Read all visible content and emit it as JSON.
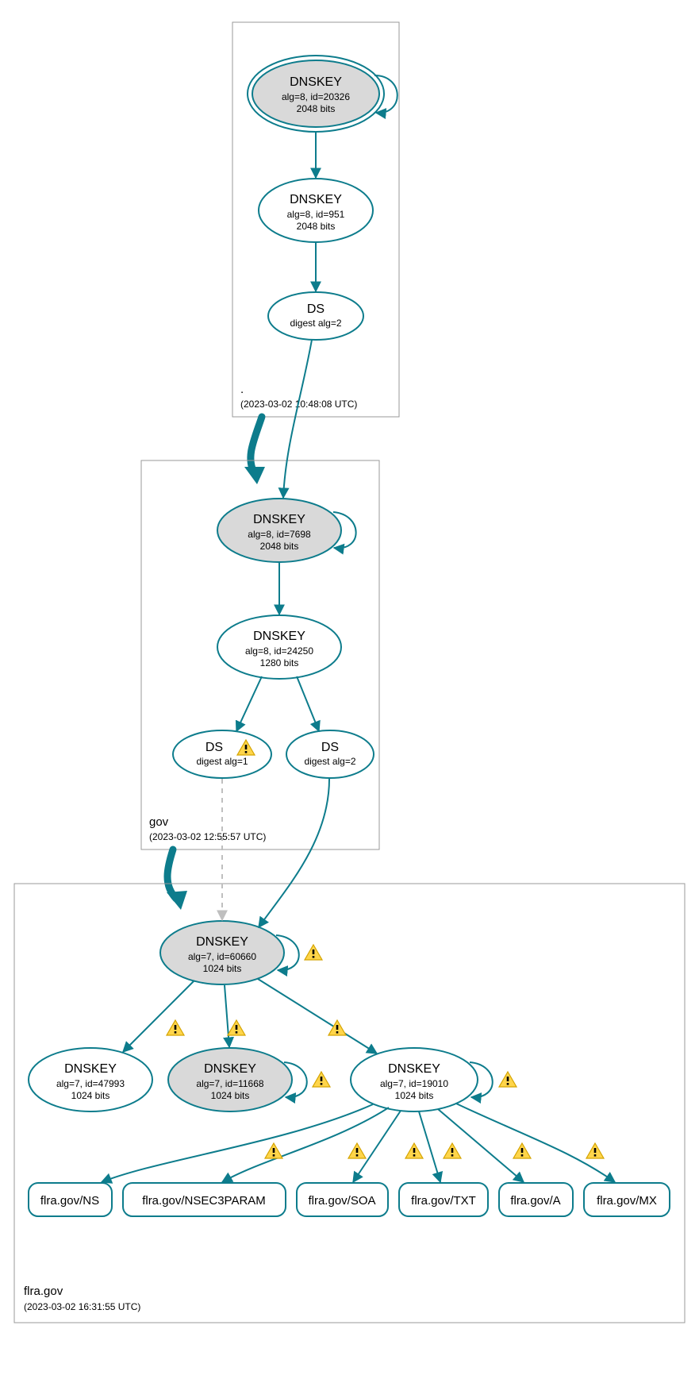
{
  "colors": {
    "stroke": "#0d7c8c",
    "fill_grey": "#d9d9d9"
  },
  "zones": {
    "root": {
      "label": ".",
      "timestamp": "(2023-03-02 10:48:08 UTC)"
    },
    "gov": {
      "label": "gov",
      "timestamp": "(2023-03-02 12:55:57 UTC)"
    },
    "flra": {
      "label": "flra.gov",
      "timestamp": "(2023-03-02 16:31:55 UTC)"
    }
  },
  "nodes": {
    "root_ksk": {
      "title": "DNSKEY",
      "line1": "alg=8, id=20326",
      "line2": "2048 bits"
    },
    "root_zsk": {
      "title": "DNSKEY",
      "line1": "alg=8, id=951",
      "line2": "2048 bits"
    },
    "root_ds": {
      "title": "DS",
      "line1": "digest alg=2"
    },
    "gov_ksk": {
      "title": "DNSKEY",
      "line1": "alg=8, id=7698",
      "line2": "2048 bits"
    },
    "gov_zsk": {
      "title": "DNSKEY",
      "line1": "alg=8, id=24250",
      "line2": "1280 bits"
    },
    "gov_ds1": {
      "title": "DS",
      "line1": "digest alg=1"
    },
    "gov_ds2": {
      "title": "DS",
      "line1": "digest alg=2"
    },
    "flra_ksk": {
      "title": "DNSKEY",
      "line1": "alg=7, id=60660",
      "line2": "1024 bits"
    },
    "flra_k47": {
      "title": "DNSKEY",
      "line1": "alg=7, id=47993",
      "line2": "1024 bits"
    },
    "flra_k11": {
      "title": "DNSKEY",
      "line1": "alg=7, id=11668",
      "line2": "1024 bits"
    },
    "flra_k19": {
      "title": "DNSKEY",
      "line1": "alg=7, id=19010",
      "line2": "1024 bits"
    }
  },
  "leaves": {
    "ns": "flra.gov/NS",
    "nsec": "flra.gov/NSEC3PARAM",
    "soa": "flra.gov/SOA",
    "txt": "flra.gov/TXT",
    "a": "flra.gov/A",
    "mx": "flra.gov/MX"
  }
}
